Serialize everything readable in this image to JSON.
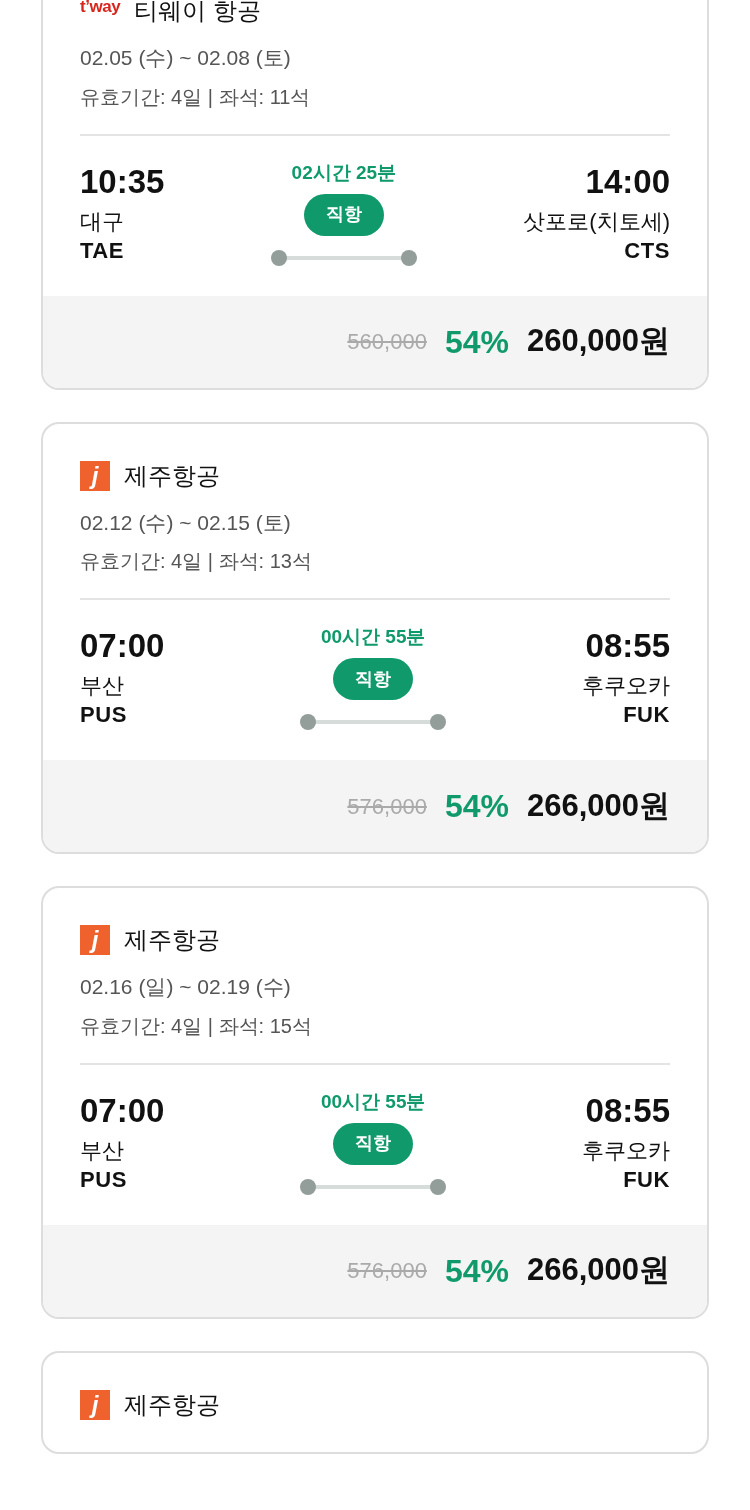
{
  "cards": [
    {
      "airline": {
        "kind": "tway",
        "logo_text": "t’way",
        "name": "티웨이 항공"
      },
      "dates": "02.05 (수) ~ 02.08 (토)",
      "info": "유효기간: 4일 | 좌석: 11석",
      "departure": {
        "time": "10:35",
        "city": "대구",
        "code": "TAE"
      },
      "duration": "02시간 25분",
      "badge": "직항",
      "arrival": {
        "time": "14:00",
        "city": "삿포로(치토세)",
        "code": "CTS"
      },
      "original_price": "560,000",
      "discount": "54%",
      "price": "260,000원"
    },
    {
      "airline": {
        "kind": "jeju",
        "logo_text": "j",
        "name": "제주항공"
      },
      "dates": "02.12 (수) ~ 02.15 (토)",
      "info": "유효기간: 4일 | 좌석: 13석",
      "departure": {
        "time": "07:00",
        "city": "부산",
        "code": "PUS"
      },
      "duration": "00시간 55분",
      "badge": "직항",
      "arrival": {
        "time": "08:55",
        "city": "후쿠오카",
        "code": "FUK"
      },
      "original_price": "576,000",
      "discount": "54%",
      "price": "266,000원"
    },
    {
      "airline": {
        "kind": "jeju",
        "logo_text": "j",
        "name": "제주항공"
      },
      "dates": "02.16 (일) ~ 02.19 (수)",
      "info": "유효기간: 4일 | 좌석: 15석",
      "departure": {
        "time": "07:00",
        "city": "부산",
        "code": "PUS"
      },
      "duration": "00시간 55분",
      "badge": "직항",
      "arrival": {
        "time": "08:55",
        "city": "후쿠오카",
        "code": "FUK"
      },
      "original_price": "576,000",
      "discount": "54%",
      "price": "266,000원"
    },
    {
      "airline": {
        "kind": "jeju",
        "logo_text": "j",
        "name": "제주항공"
      }
    }
  ]
}
